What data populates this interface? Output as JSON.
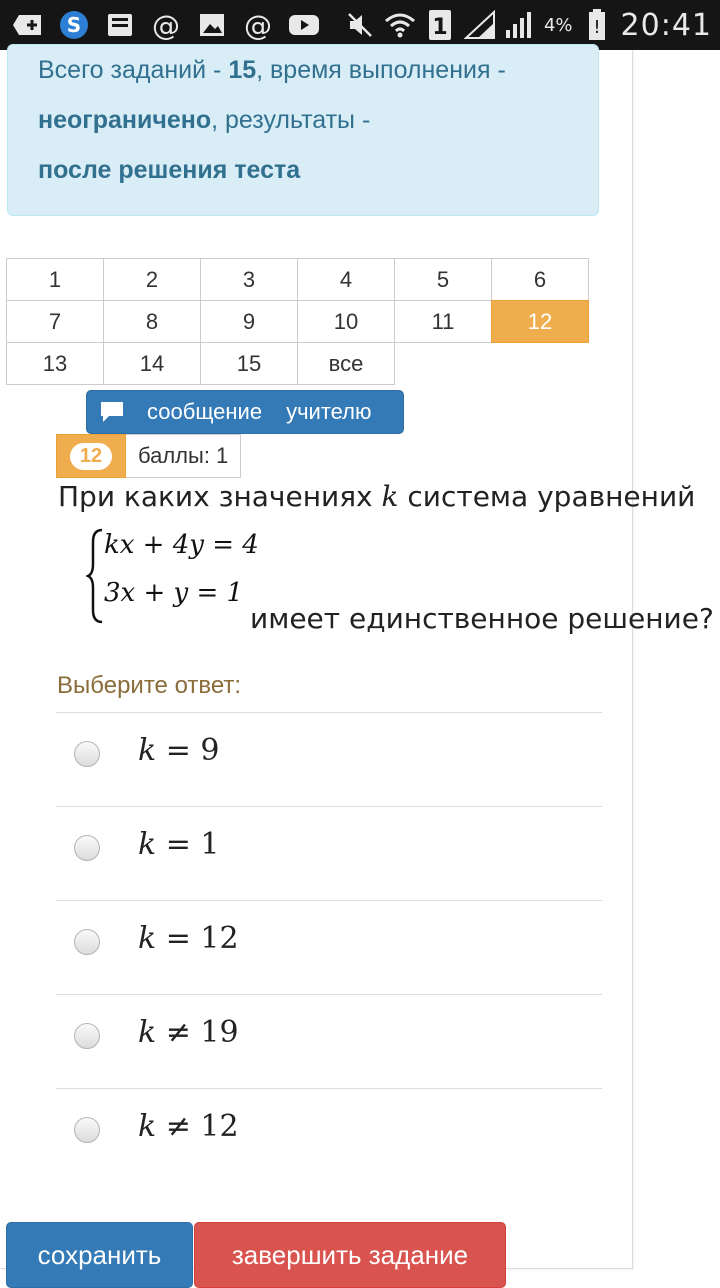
{
  "status_bar": {
    "time": "20:41",
    "battery_percent": "4%",
    "icons": [
      "add-icon",
      "skype-icon",
      "inbox-icon",
      "at-icon",
      "gallery-icon",
      "at-icon",
      "youtube-icon",
      "mute-icon",
      "wifi-icon",
      "sim-1-icon",
      "signal-icon",
      "signal-icon",
      "battery-low-icon"
    ]
  },
  "info": {
    "line1_prefix": "Всего заданий - ",
    "line1_count": "15",
    "line1_suffix": ", время выполнения -",
    "line2_bold": "неограничено",
    "line2_suffix": ", результаты -",
    "line3_bold": "после решения теста"
  },
  "nav": {
    "rows": [
      [
        "1",
        "2",
        "3",
        "4",
        "5",
        "6"
      ],
      [
        "7",
        "8",
        "9",
        "10",
        "11",
        "12"
      ],
      [
        "13",
        "14",
        "15",
        "все"
      ]
    ],
    "active": "12"
  },
  "message_button": {
    "word1": "сообщение",
    "word2": "учителю"
  },
  "score": {
    "number": "12",
    "label": "баллы: 1"
  },
  "question": {
    "prefix": "При каких значениях ",
    "var": "k",
    "suffix": " система уравнений",
    "eq1": "kx + 4y = 4",
    "eq2": "3x + y = 1",
    "tail": "имеет единственное решение?"
  },
  "choose_label": "Выберите ответ:",
  "answers": [
    {
      "var": "k",
      "op": "=",
      "value": "9"
    },
    {
      "var": "k",
      "op": "=",
      "value": "1"
    },
    {
      "var": "k",
      "op": "=",
      "value": "12"
    },
    {
      "var": "k",
      "op": "≠",
      "value": "19"
    },
    {
      "var": "k",
      "op": "≠",
      "value": "12"
    }
  ],
  "buttons": {
    "save": "сохранить",
    "finish": "завершить задание"
  },
  "colors": {
    "info_bg": "#d9edf7",
    "info_text": "#31708f",
    "active_orange": "#f0ad4e",
    "primary_blue": "#337ab7",
    "danger_red": "#d9534f",
    "label_brown": "#8a6d3b"
  }
}
